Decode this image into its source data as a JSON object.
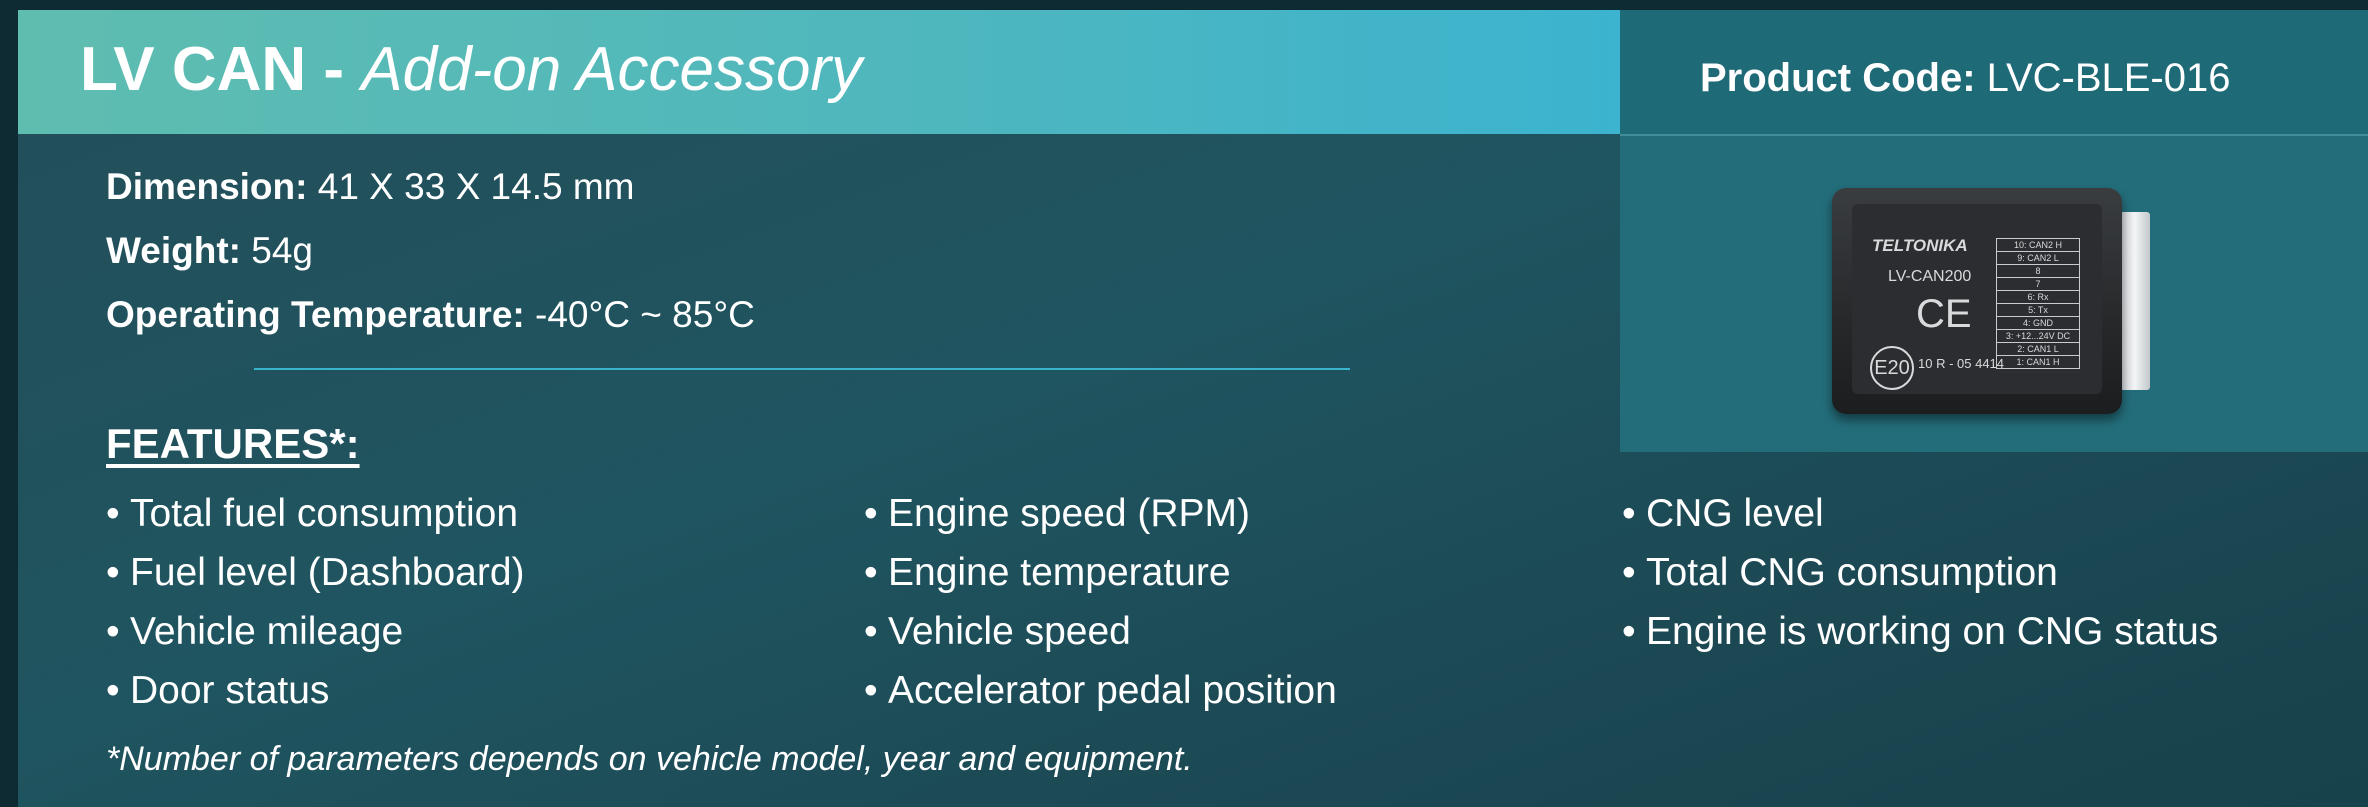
{
  "header": {
    "title_main": "LV CAN - ",
    "title_sub": "Add-on Accessory",
    "product_code_label": "Product Code:",
    "product_code_value": " LVC-BLE-016"
  },
  "specs": [
    {
      "label": "Dimension:",
      "value": " 41 X 33 X 14.5 mm"
    },
    {
      "label": "Weight:",
      "value": " 54g"
    },
    {
      "label": "Operating Temperature:",
      "value": " -40°C ~ 85°C"
    }
  ],
  "features": {
    "title": "FEATURES*:",
    "bullet": "•",
    "columns": [
      [
        "Total fuel consumption",
        "Fuel level (Dashboard)",
        "Vehicle mileage",
        "Door status"
      ],
      [
        "Engine speed (RPM)",
        "Engine temperature",
        "Vehicle speed",
        "Accelerator pedal position"
      ],
      [
        "CNG level",
        "Total CNG consumption",
        "Engine is working on CNG status"
      ]
    ]
  },
  "footnote": "*Number of parameters depends on vehicle model, year and equipment.",
  "device": {
    "brand": "TELTONIKA",
    "model": "LV-CAN200",
    "ce_mark": "CE",
    "e_mark": "E20",
    "approval": "10 R - 05 4414",
    "pins": [
      "10: CAN2 H",
      "9: CAN2 L",
      "8",
      "7",
      "6: Rx",
      "5: Tx",
      "4: GND",
      "3: +12...24V DC",
      "2: CAN1 L",
      "1: CAN1 H"
    ]
  },
  "colors": {
    "header_gradient_start": "#5fbdb0",
    "header_gradient_end": "#3cb3cf",
    "panel_background": "#1f5560",
    "divider": "#3ab3cc"
  }
}
